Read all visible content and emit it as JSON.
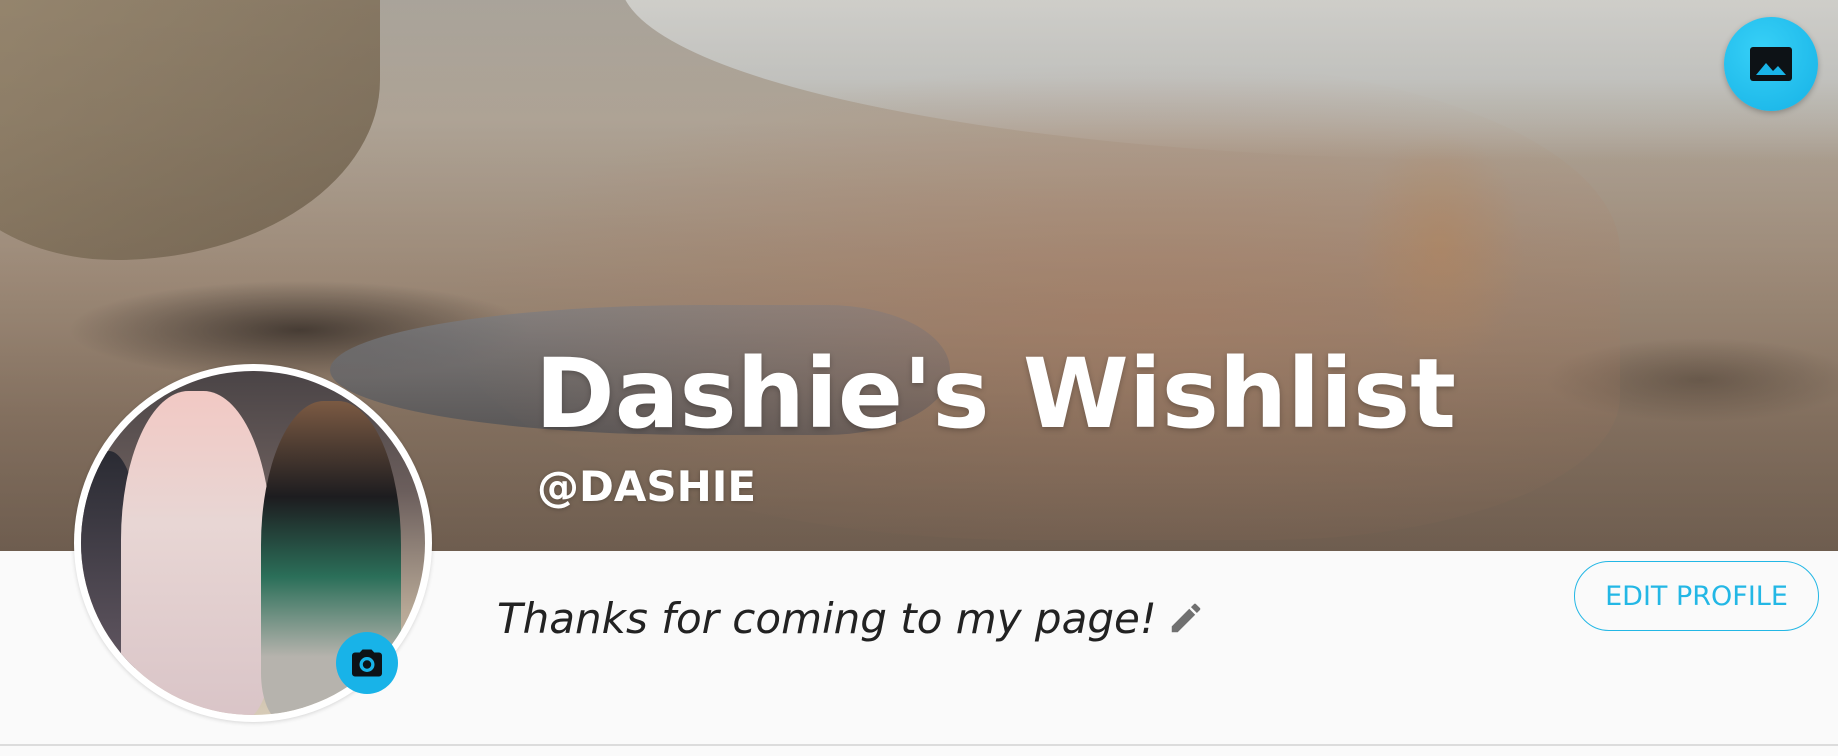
{
  "cover": {
    "change_cover_icon": "image-icon"
  },
  "profile": {
    "wishlist_title": "Dashie's Wishlist",
    "username": "@DASHIE",
    "tagline": "Thanks for coming to my page!",
    "edit_tagline_icon": "pencil-icon",
    "edit_profile_label": "EDIT PROFILE",
    "avatar_camera_icon": "camera-icon"
  },
  "colors": {
    "accent": "#18b3e8",
    "background": "#fafafa",
    "title_text": "#ffffff",
    "tagline_text": "#222222"
  }
}
